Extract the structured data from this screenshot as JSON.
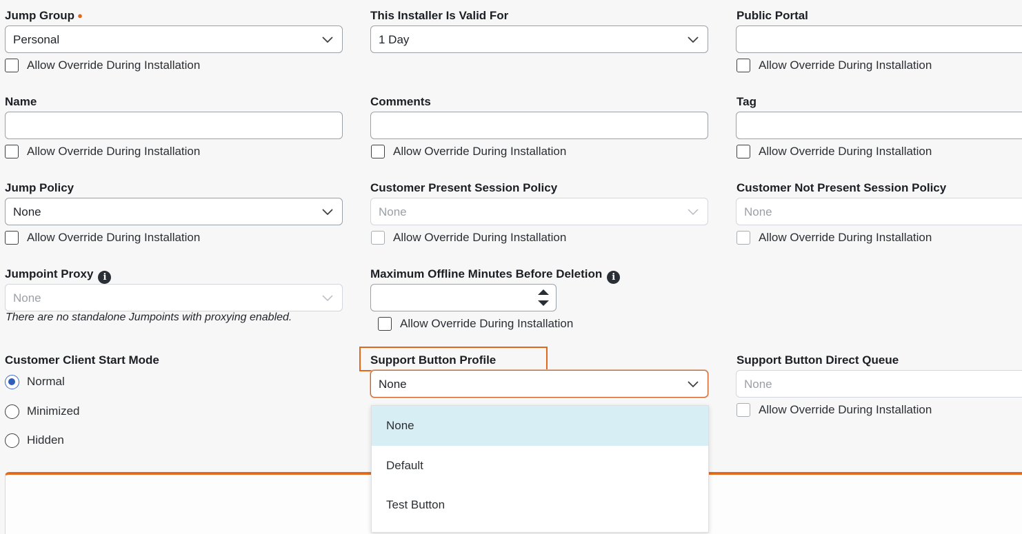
{
  "override_label": "Allow Override During Installation",
  "jump_group": {
    "label": "Jump Group",
    "required_marker": "●",
    "value": "Personal"
  },
  "installer_valid": {
    "label": "This Installer Is Valid For",
    "value": "1 Day"
  },
  "public_portal": {
    "label": "Public Portal",
    "value": ""
  },
  "name": {
    "label": "Name",
    "value": ""
  },
  "comments": {
    "label": "Comments",
    "value": ""
  },
  "tag": {
    "label": "Tag",
    "value": ""
  },
  "jump_policy": {
    "label": "Jump Policy",
    "value": "None"
  },
  "customer_present_policy": {
    "label": "Customer Present Session Policy",
    "value": "None"
  },
  "customer_not_present_policy": {
    "label": "Customer Not Present Session Policy",
    "value": "None"
  },
  "jumpoint_proxy": {
    "label": "Jumpoint Proxy",
    "value": "None",
    "note": "There are no standalone Jumpoints with proxying enabled."
  },
  "max_offline": {
    "label": "Maximum Offline Minutes Before Deletion",
    "value": ""
  },
  "start_mode": {
    "label": "Customer Client Start Mode",
    "options": [
      "Normal",
      "Minimized",
      "Hidden"
    ],
    "selected": "Normal"
  },
  "support_button_profile": {
    "label": "Support Button Profile",
    "value": "None",
    "options": [
      "None",
      "Default",
      "Test Button"
    ],
    "highlighted": "None"
  },
  "support_button_queue": {
    "label": "Support Button Direct Queue",
    "value": "None"
  },
  "icons": {
    "info": "info-icon",
    "chevron": "chevron-down-icon",
    "spinner": "spinner-arrows-icon"
  },
  "colors": {
    "accent": "#e4661b",
    "selected_option": "#d8eef5",
    "radio_on": "#2f5fb8"
  }
}
